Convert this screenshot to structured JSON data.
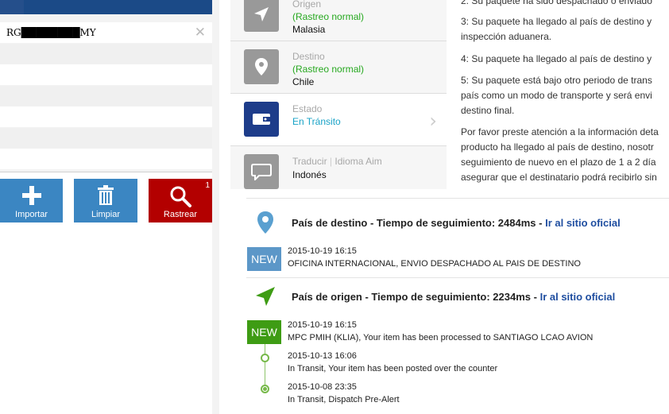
{
  "left": {
    "tracking_number": "RG████████MY",
    "buttons": {
      "import_label": "Importar",
      "clear_label": "Limpiar",
      "track_label": "Rastrear",
      "track_badge": "1"
    }
  },
  "info": {
    "origin": {
      "label": "Origen",
      "status": "(Rastreo normal)",
      "value": "Malasia"
    },
    "destination": {
      "label": "Destino",
      "status": "(Rastreo normal)",
      "value": "Chile"
    },
    "state": {
      "label": "Estado",
      "value": "En Tránsito"
    },
    "translate": {
      "label": "Traducir",
      "divider": "|",
      "link": "Idioma Aim",
      "value": "Indonés"
    }
  },
  "right_text": {
    "lines": [
      "2: Su paquete ha sido despachado o enviado",
      "3: Su paquete ha llegado al país de destino y",
      "inspección aduanera.",
      "4: Su paquete ha llegado al país de destino y",
      "5: Su paquete está bajo otro periodo de trans",
      "país como un modo de transporte y será envi",
      "destino final.",
      "Por favor preste atención a la información deta",
      "producto ha llegado al país de destino, nosotr",
      "seguimiento de nuevo en el plazo de 1 a 2 día",
      "asegurar que el destinatario podrá recibirlo sin"
    ]
  },
  "tracking": {
    "destination": {
      "title": "País de destino - Tiempo de seguimiento: 2484ms - ",
      "link": "Ir al sitio oficial",
      "badge": "NEW",
      "events": [
        {
          "time": "2015-10-19 16:15",
          "desc": "OFICINA INTERNACIONAL, ENVIO DESPACHADO AL PAIS DE DESTINO"
        }
      ]
    },
    "origin": {
      "title": "País de origen - Tiempo de seguimiento: 2234ms - ",
      "link": "Ir al sitio oficial",
      "badge": "NEW",
      "events": [
        {
          "time": "2015-10-19 16:15",
          "desc": "MPC PMIH (KLIA), Your item has been processed to SANTIAGO LCAO AVION"
        },
        {
          "time": "2015-10-13 16:06",
          "desc": "In Transit, Your item has been posted over the counter"
        },
        {
          "time": "2015-10-08 23:35",
          "desc": "In Transit, Dispatch Pre-Alert"
        }
      ]
    }
  },
  "colors": {
    "header_blue": "#1b4a87",
    "button_blue": "#3b86c2",
    "button_red": "#b30000",
    "status_green": "#26a81f",
    "status_teal": "#19a3c7",
    "link_blue": "#1f4ea0",
    "badge_blue": "#5c97c8",
    "badge_green": "#3e9c14"
  }
}
